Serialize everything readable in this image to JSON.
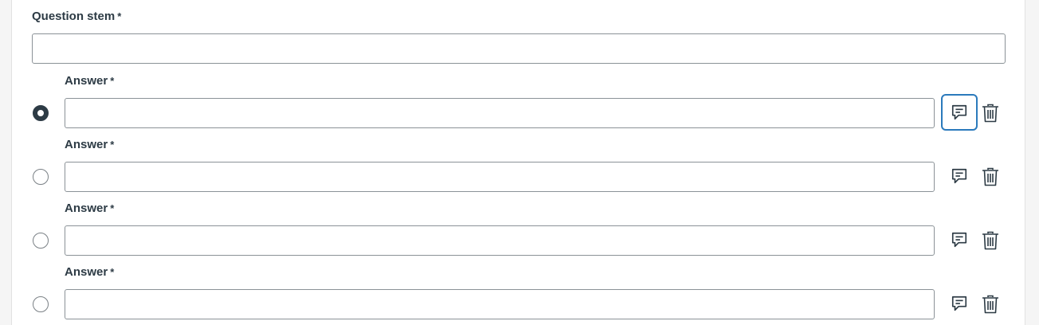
{
  "question": {
    "label": "Question stem",
    "required_mark": "*",
    "value": ""
  },
  "answers": [
    {
      "label": "Answer",
      "required_mark": "*",
      "value": "",
      "selected": true
    },
    {
      "label": "Answer",
      "required_mark": "*",
      "value": "",
      "selected": false
    },
    {
      "label": "Answer",
      "required_mark": "*",
      "value": "",
      "selected": false
    },
    {
      "label": "Answer",
      "required_mark": "*",
      "value": "",
      "selected": false
    }
  ],
  "icons": {
    "feedback": "comment-icon",
    "delete": "trash-icon"
  },
  "colors": {
    "text": "#2d3b45",
    "focus": "#2b7abc",
    "border": "#8b9297"
  }
}
